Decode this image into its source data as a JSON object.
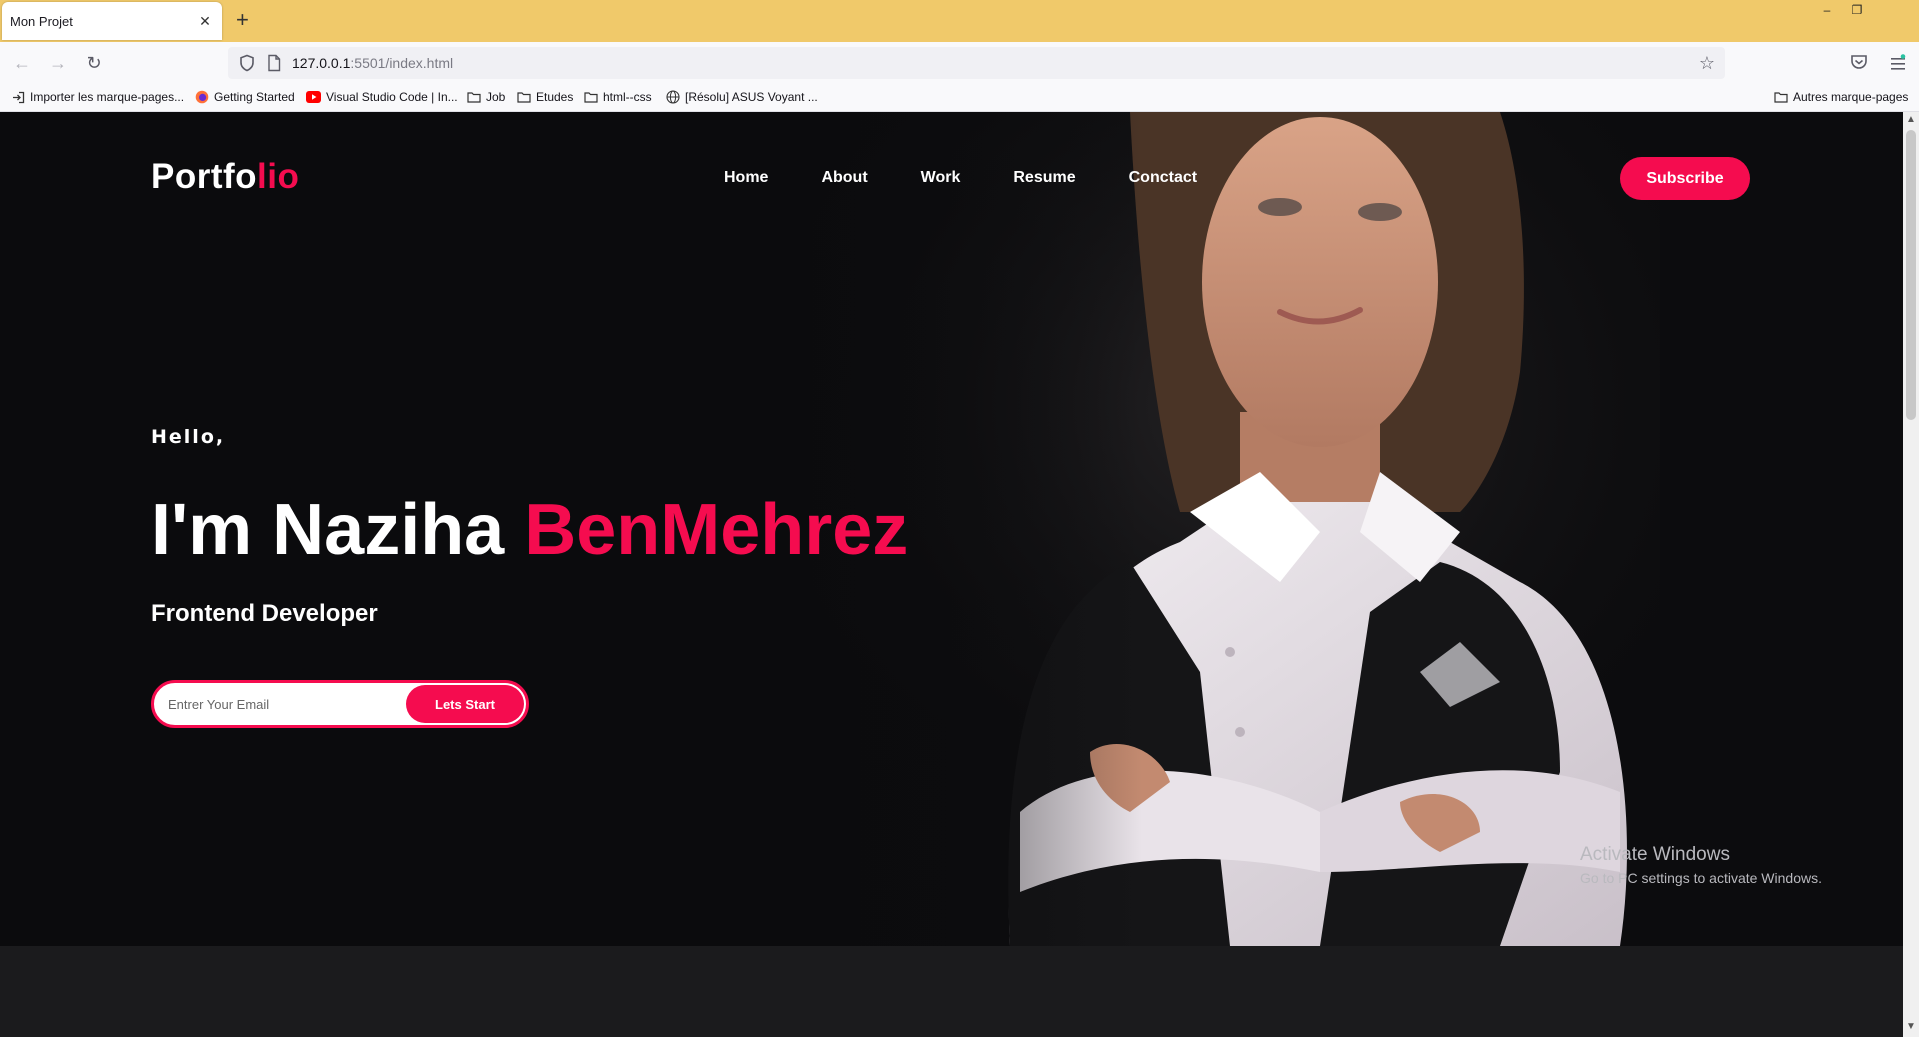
{
  "browser": {
    "tab_title": "Mon Projet",
    "tab_close": "✕",
    "new_tab": "+",
    "url_host": "127.0.0.1",
    "url_rest": ":5501/index.html",
    "window_minimize": "–",
    "window_restore": "❐",
    "bookmarks": [
      {
        "label": "Importer les marque-pages...",
        "icon": "import-icon"
      },
      {
        "label": "Getting Started",
        "icon": "firefox-icon"
      },
      {
        "label": "Visual Studio Code | In...",
        "icon": "youtube-icon"
      },
      {
        "label": "Job",
        "icon": "folder-icon"
      },
      {
        "label": "Etudes",
        "icon": "folder-icon"
      },
      {
        "label": "html--css",
        "icon": "folder-icon"
      },
      {
        "label": "[Résolu] ASUS Voyant ...",
        "icon": "globe-icon"
      }
    ],
    "other_bookmarks": "Autres marque-pages"
  },
  "site": {
    "logo_main": "Portfo",
    "logo_accent": "lio",
    "nav": [
      "Home",
      "About",
      "Work",
      "Resume",
      "Conctact"
    ],
    "subscribe": "Subscribe",
    "greeting": "Hello,",
    "name_main": "I'm Naziha ",
    "name_accent": "BenMehrez",
    "role": "Frontend Developer",
    "email_placeholder": "Entrer Your Email",
    "cta": "Lets Start"
  },
  "os_overlay": {
    "line1": "Activate Windows",
    "line2": "Go to PC settings to activate Windows."
  },
  "colors": {
    "accent": "#f50c4f",
    "tabbar": "#f0c96a",
    "hero_bg": "#0c0c0e"
  }
}
